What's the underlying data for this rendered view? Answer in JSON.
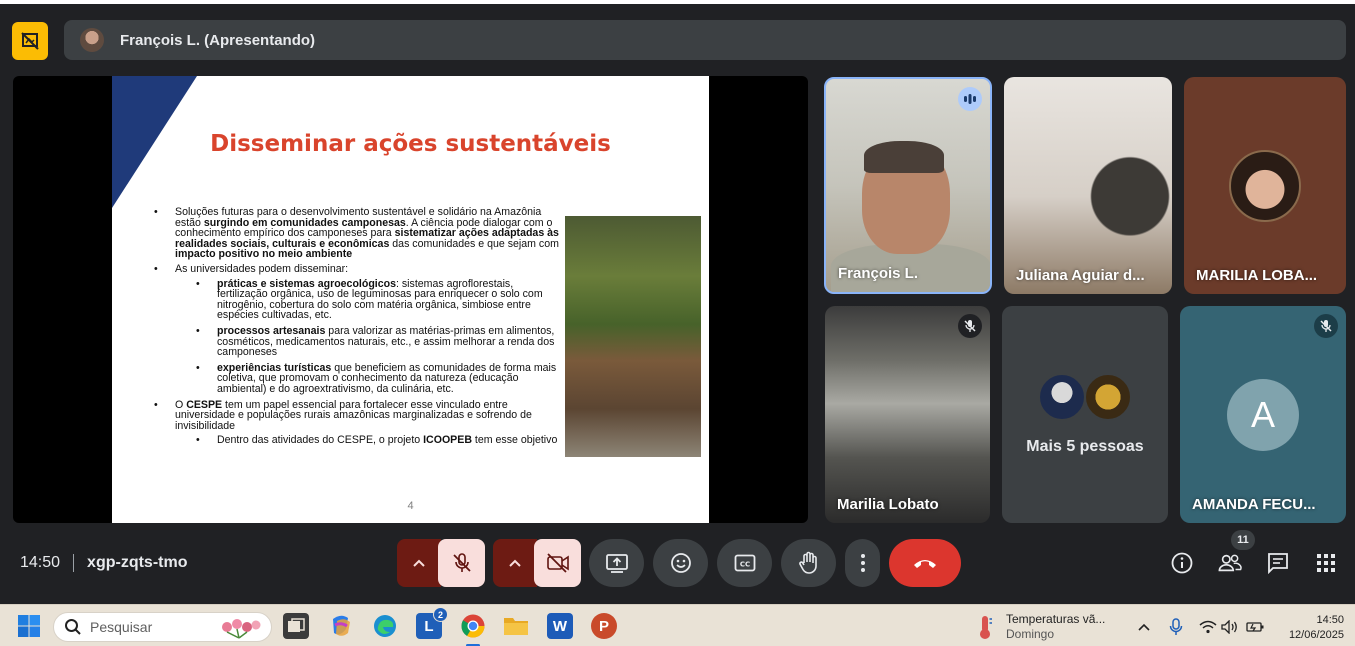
{
  "presenter_banner": {
    "name": "François L. (Apresentando)"
  },
  "slide": {
    "title": "Disseminar ações sustentáveis",
    "page_number": "4",
    "bullets": {
      "b1_pre": "Soluções futuras para o desenvolvimento sustentável e solidário na Amazônia estão ",
      "b1_bold": "surgindo em comunidades camponesas",
      "b1_mid": ". A ciência pode dialogar com o conhecimento empírico dos camponeses para ",
      "b1_bold2": "sistematizar ações adaptadas às realidades sociais, culturais e econômicas",
      "b1_mid2": " das comunidades e que sejam com ",
      "b1_bold3": "impacto positivo no meio ambiente",
      "b2": "As universidades podem disseminar:",
      "b2a_bold": "práticas e sistemas agroecológicos",
      "b2a_text": ": sistemas agroflorestais, fertilização orgânica, uso de leguminosas para enriquecer o solo com nitrogênio, cobertura do solo com matéria orgânica, simbiose entre espécies cultivadas, etc.",
      "b2b_bold": "processos artesanais",
      "b2b_text": " para valorizar as matérias-primas em alimentos, cosméticos, medicamentos naturais, etc., e assim melhorar a renda dos camponeses",
      "b2c_bold": "experiências turísticas",
      "b2c_text": " que beneficiem as comunidades de forma mais coletiva, que promovam o conhecimento da natureza (educação ambiental) e do agroextrativismo, da culinária, etc.",
      "b3_pre": "O ",
      "b3_bold": "CESPE",
      "b3_text": " tem um papel essencial para fortalecer esse vinculado entre universidade e populações rurais amazônicas marginalizadas e sofrendo de invisibilidade",
      "b3a_pre": "Dentro das atividades do CESPE, o projeto ",
      "b3a_bold": "ICOOPEB",
      "b3a_text": " tem esse objetivo"
    }
  },
  "participants": [
    {
      "name": "François L.",
      "state": "speaking"
    },
    {
      "name": "Juliana Aguiar d..."
    },
    {
      "name": "MARILIA LOBA..."
    },
    {
      "name": "Marilia Lobato",
      "state": "muted"
    },
    {
      "name": "Mais 5 pessoas"
    },
    {
      "name": "AMANDA FECU...",
      "initial": "A",
      "state": "muted"
    }
  ],
  "meeting": {
    "time": "14:50",
    "code": "xgp-zqts-tmo",
    "participant_count": "11"
  },
  "taskbar": {
    "search_placeholder": "Pesquisar",
    "weather_title": "Temperaturas vã...",
    "weather_sub": "Domingo",
    "clock_time": "14:50",
    "clock_date": "12/06/2025",
    "outlook_badge": "2"
  },
  "colors": {
    "present_toggle": "#fbbc04",
    "end_call": "#dc362e",
    "slide_title": "#d9442c",
    "speaking_border": "#8ab4f8"
  }
}
